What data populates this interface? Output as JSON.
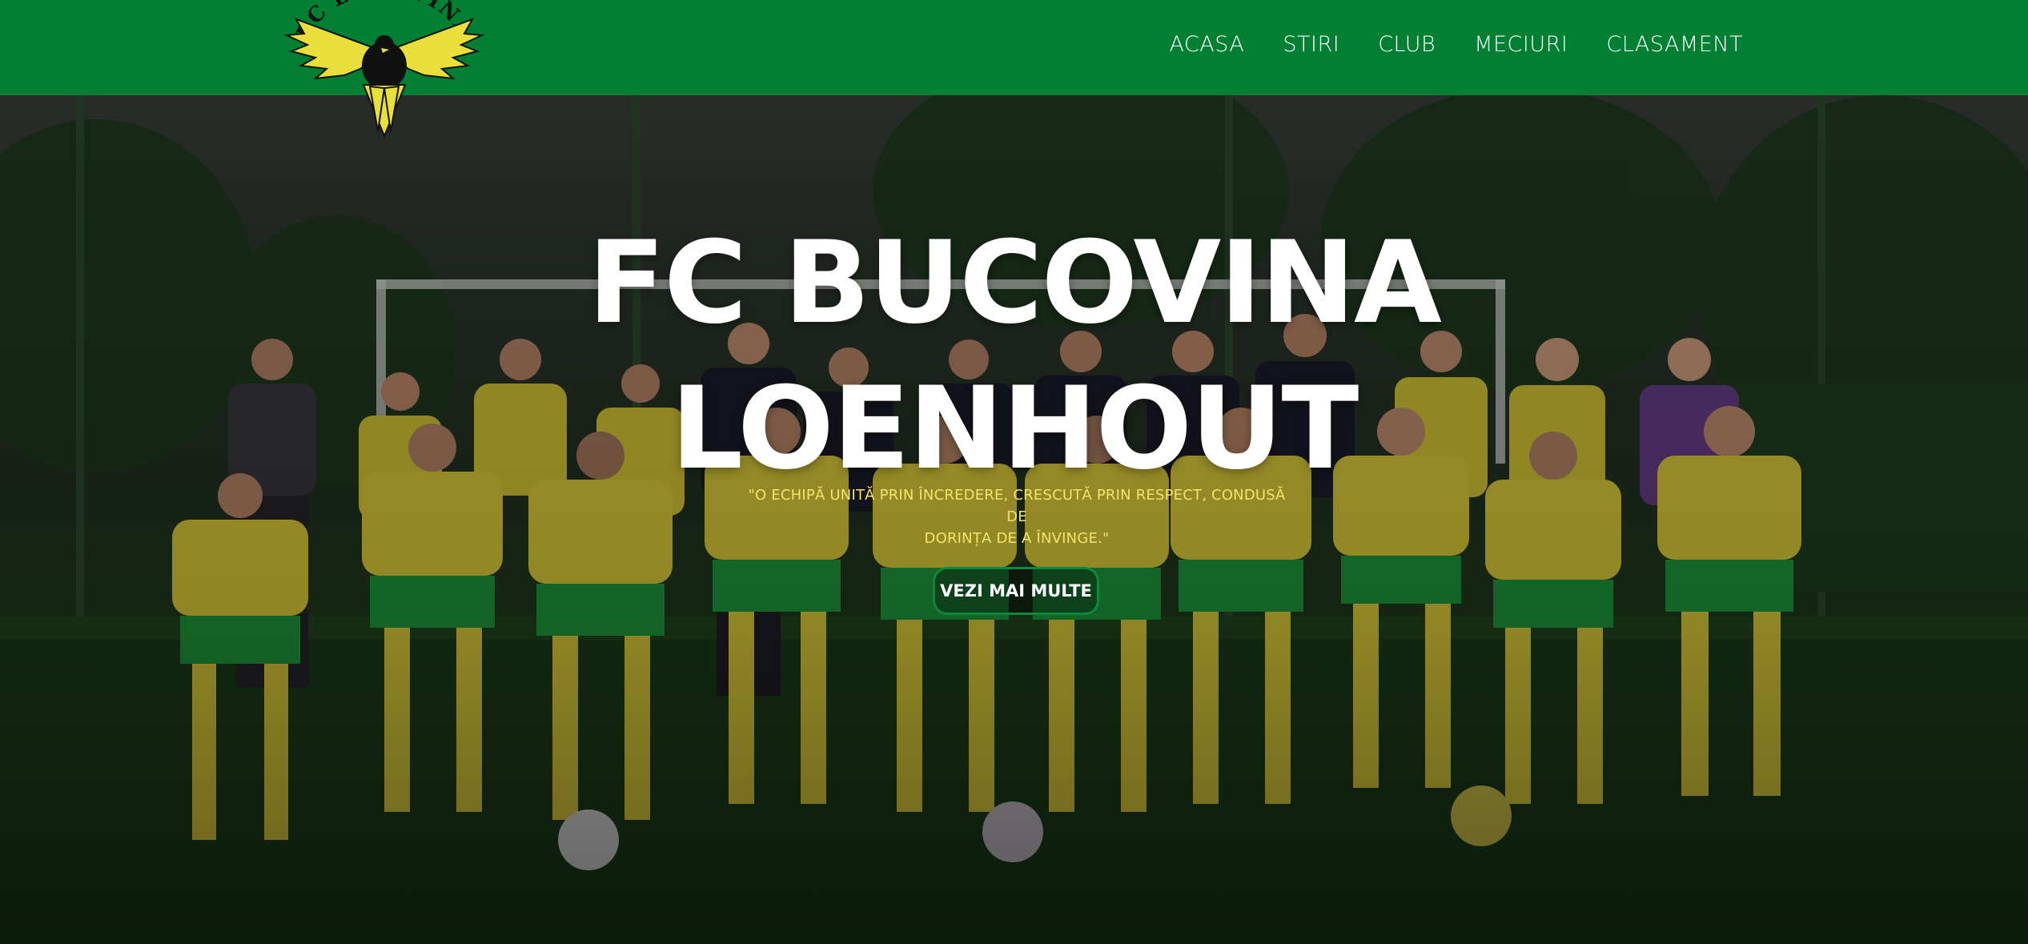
{
  "brand": {
    "logo_text": "FC BUCOVINA",
    "logo_icon": "eagle-crest-icon"
  },
  "nav": {
    "items": [
      {
        "label": "ACASA"
      },
      {
        "label": "STIRI"
      },
      {
        "label": "CLUB"
      },
      {
        "label": "MECIURI"
      },
      {
        "label": "CLASAMENT"
      }
    ]
  },
  "hero": {
    "title_line1": "FC BUCOVINA",
    "title_line2": "LOENHOUT",
    "quote_line1": "\"O ECHIPĂ UNITĂ PRIN ÎNCREDERE, CRESCUTĂ PRIN RESPECT, CONDUSĂ DE",
    "quote_line2": "DORINȚA DE A ÎNVINGE.\"",
    "cta_label": "VEZI MAI MULTE"
  },
  "colors": {
    "header_green": "#018033",
    "cta_border": "#0a8a3a",
    "quote_yellow": "#f3e36b",
    "kit_yellow": "#e8d63a",
    "kit_green": "#1f9a3c"
  }
}
